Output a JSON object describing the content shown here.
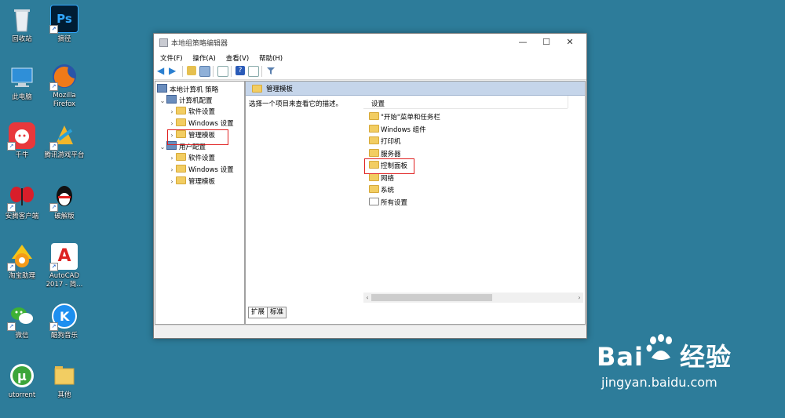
{
  "desktop": {
    "icons": [
      {
        "label": "回收站"
      },
      {
        "label": "摘径"
      },
      {
        "label": "此电脑"
      },
      {
        "label": "Mozilla Firefox"
      },
      {
        "label": "千牛"
      },
      {
        "label": "腾讯游戏平台"
      },
      {
        "label": "安腾客户端"
      },
      {
        "label": "破解版"
      },
      {
        "label": "淘宝助理"
      },
      {
        "label": "AutoCAD 2017 - 简..."
      },
      {
        "label": "微信"
      },
      {
        "label": "酷狗音乐"
      },
      {
        "label": "utorrent"
      },
      {
        "label": "其他"
      }
    ]
  },
  "window": {
    "title": "本地组策略编辑器",
    "controls": {
      "minimize": "—",
      "maximize": "☐",
      "close": "✕"
    },
    "menu": [
      "文件(F)",
      "操作(A)",
      "查看(V)",
      "帮助(H)"
    ],
    "tree": {
      "root": "本地计算机 策略",
      "computer_config": "计算机配置",
      "computer_children": [
        "软件设置",
        "Windows 设置",
        "管理模板"
      ],
      "user_config": "用户配置",
      "user_children": [
        "软件设置",
        "Windows 设置",
        "管理模板"
      ]
    },
    "right": {
      "header": "管理模板",
      "description": "选择一个项目来查看它的描述。",
      "column": "设置",
      "items": [
        "\"开始\"菜单和任务栏",
        "Windows 组件",
        "打印机",
        "服务器",
        "控制面板",
        "网络",
        "系统",
        "所有设置"
      ]
    },
    "tabs": [
      "扩展",
      "标准"
    ]
  },
  "watermark": {
    "brand_left": "Bai",
    "brand_right": "经验",
    "url": "jingyan.baidu.com"
  },
  "colors": {
    "desktop": "#2d7c9a",
    "highlight_box": "#e02020",
    "header_bar": "#c5d5ea",
    "folder": "#f2cd62"
  }
}
